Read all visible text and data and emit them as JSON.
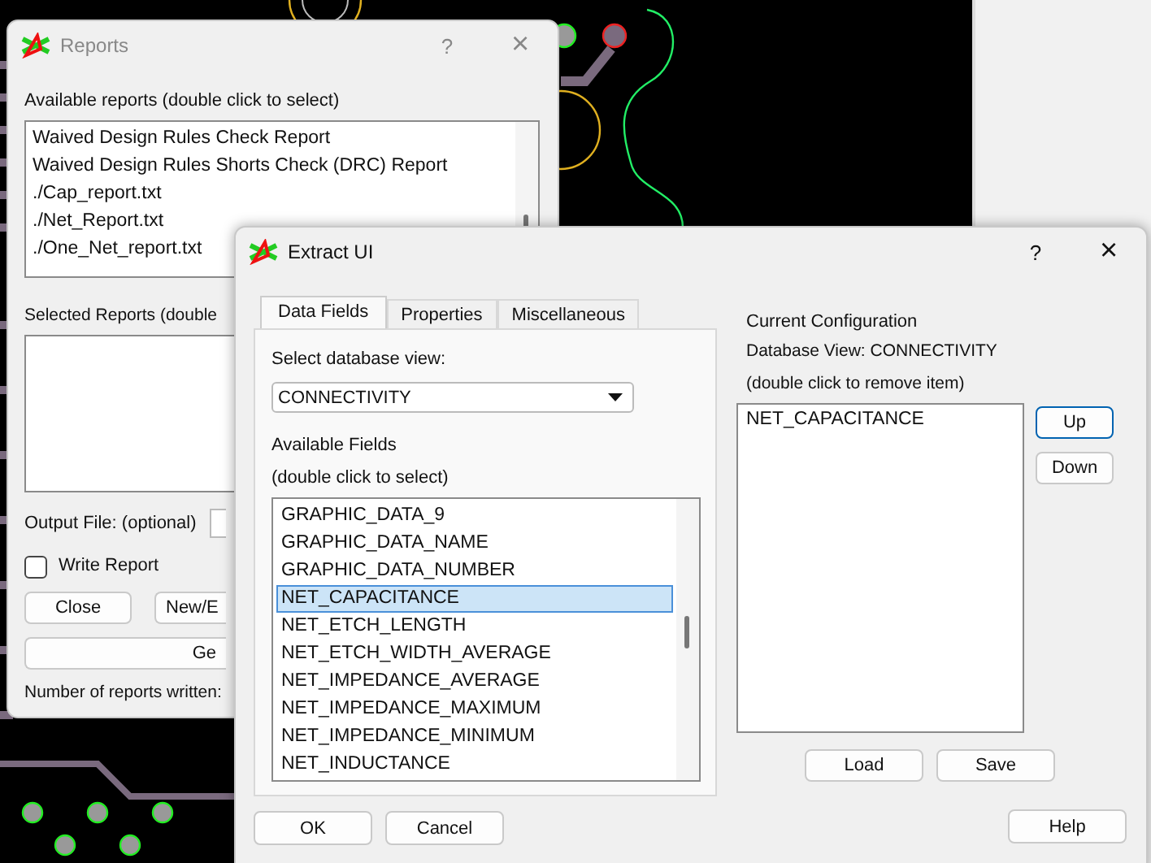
{
  "reports_window": {
    "title": "Reports",
    "help": "?",
    "close": "×",
    "available_label": "Available reports (double click to select)",
    "available_reports": [
      "Waived Design Rules Check Report",
      "Waived Design Rules Shorts Check (DRC) Report",
      "./Cap_report.txt",
      "./Net_Report.txt",
      "./One_Net_report.txt"
    ],
    "selected_label": "Selected Reports (double",
    "output_label": "Output File: (optional)",
    "write_report": {
      "label": "Write Report",
      "checked": false
    },
    "buttons": [
      "Close",
      "New/E"
    ],
    "generate_button": "Ge",
    "count_label": "Number of reports written:"
  },
  "extract_window": {
    "title": "Extract UI",
    "help": "?",
    "close": "×",
    "tabs": [
      {
        "label": "Data Fields",
        "selected": true
      },
      {
        "label": "Properties",
        "selected": false
      },
      {
        "label": "Miscellaneous",
        "selected": false
      }
    ],
    "view_label": "Select database view:",
    "view_value": "CONNECTIVITY",
    "fields_label": "Available Fields",
    "fields_hint": "(double click to select)",
    "fields": [
      {
        "label": "GRAPHIC_DATA_9",
        "selected": false
      },
      {
        "label": "GRAPHIC_DATA_NAME",
        "selected": false
      },
      {
        "label": "GRAPHIC_DATA_NUMBER",
        "selected": false
      },
      {
        "label": "NET_CAPACITANCE",
        "selected": true
      },
      {
        "label": "NET_ETCH_LENGTH",
        "selected": false
      },
      {
        "label": "NET_ETCH_WIDTH_AVERAGE",
        "selected": false
      },
      {
        "label": "NET_IMPEDANCE_AVERAGE",
        "selected": false
      },
      {
        "label": "NET_IMPEDANCE_MAXIMUM",
        "selected": false
      },
      {
        "label": "NET_IMPEDANCE_MINIMUM",
        "selected": false
      },
      {
        "label": "NET_INDUCTANCE",
        "selected": false
      }
    ],
    "config_title": "Current Configuration",
    "config_view": "Database View: CONNECTIVITY",
    "config_hint": "(double click to remove item)",
    "config_items": [
      "NET_CAPACITANCE"
    ],
    "move_buttons": [
      {
        "label": "Up",
        "focused": true
      },
      {
        "label": "Down",
        "focused": false
      }
    ],
    "list_buttons": [
      "Load",
      "Save"
    ],
    "ok": "OK",
    "cancel": "Cancel",
    "help_button": "Help"
  }
}
